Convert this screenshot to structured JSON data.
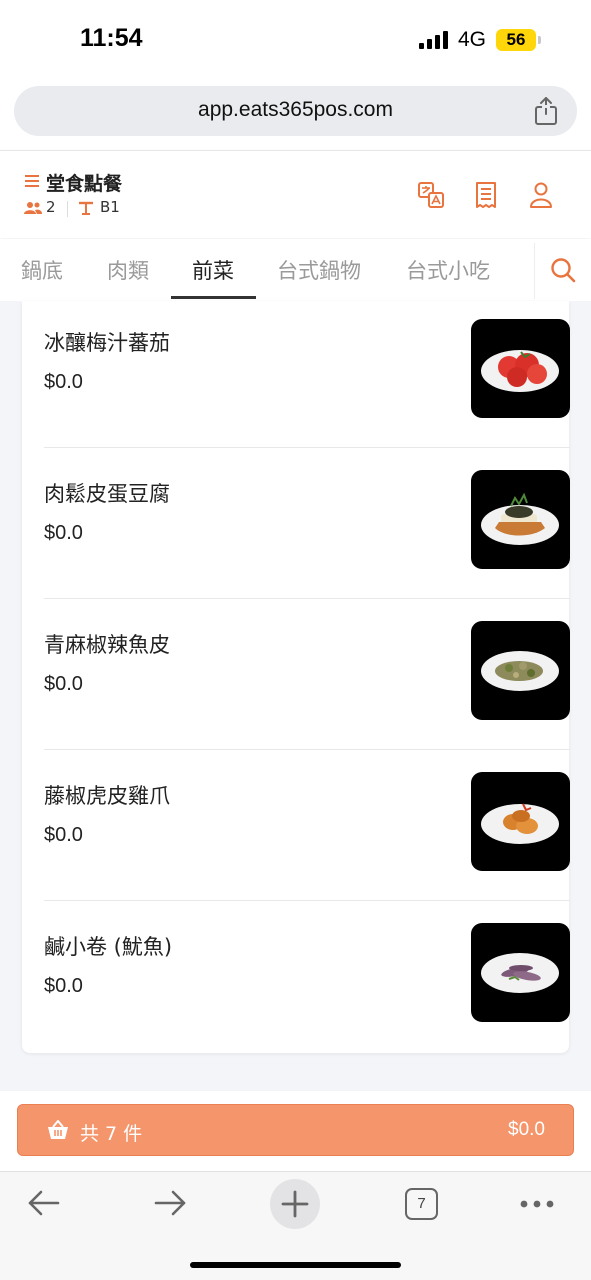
{
  "status_bar": {
    "time": "11:54",
    "network": "4G",
    "battery": "56"
  },
  "browser": {
    "url": "app.eats365pos.com",
    "open_tabs": "7"
  },
  "header": {
    "title": "堂食點餐",
    "guests": "2",
    "table": "B1"
  },
  "tabs": [
    {
      "label": "鍋底",
      "active": false
    },
    {
      "label": "肉類",
      "active": false
    },
    {
      "label": "前菜",
      "active": true
    },
    {
      "label": "台式鍋物",
      "active": false
    },
    {
      "label": "台式小吃",
      "active": false
    }
  ],
  "menu_items": [
    {
      "name": "冰釀梅汁蕃茄",
      "price": "$0.0"
    },
    {
      "name": "肉鬆皮蛋豆腐",
      "price": "$0.0"
    },
    {
      "name": "青麻椒辣魚皮",
      "price": "$0.0"
    },
    {
      "name": "藤椒虎皮雞爪",
      "price": "$0.0"
    },
    {
      "name": "鹹小卷 (魷魚)",
      "price": "$0.0"
    }
  ],
  "cart": {
    "count_label": "共 7 件",
    "total": "$0.0"
  },
  "colors": {
    "accent": "#f4956b",
    "accent_dark": "#e8743f",
    "text": "#222222",
    "muted": "#9a9a9a"
  }
}
